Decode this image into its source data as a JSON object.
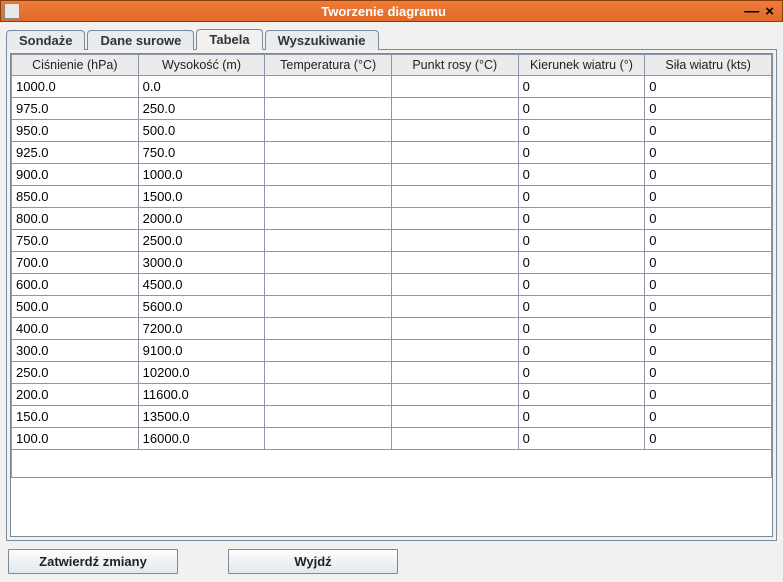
{
  "titlebar": {
    "title": "Tworzenie diagramu",
    "minimize": "—",
    "close": "×"
  },
  "tabs": {
    "items": [
      {
        "label": "Sondaże"
      },
      {
        "label": "Dane surowe"
      },
      {
        "label": "Tabela"
      },
      {
        "label": "Wyszukiwanie"
      }
    ]
  },
  "table": {
    "headers": {
      "pressure": "Ciśnienie (hPa)",
      "height": "Wysokość (m)",
      "temperature": "Temperatura (°C)",
      "dewpoint": "Punkt rosy (°C)",
      "winddir": "Kierunek wiatru (°)",
      "windspeed": "Siła wiatru (kts)"
    },
    "rows": [
      {
        "pressure": "1000.0",
        "height": "0.0",
        "temperature": "",
        "dewpoint": "",
        "winddir": "0",
        "windspeed": "0"
      },
      {
        "pressure": "975.0",
        "height": "250.0",
        "temperature": "",
        "dewpoint": "",
        "winddir": "0",
        "windspeed": "0"
      },
      {
        "pressure": "950.0",
        "height": "500.0",
        "temperature": "",
        "dewpoint": "",
        "winddir": "0",
        "windspeed": "0"
      },
      {
        "pressure": "925.0",
        "height": "750.0",
        "temperature": "",
        "dewpoint": "",
        "winddir": "0",
        "windspeed": "0"
      },
      {
        "pressure": "900.0",
        "height": "1000.0",
        "temperature": "",
        "dewpoint": "",
        "winddir": "0",
        "windspeed": "0"
      },
      {
        "pressure": "850.0",
        "height": "1500.0",
        "temperature": "",
        "dewpoint": "",
        "winddir": "0",
        "windspeed": "0"
      },
      {
        "pressure": "800.0",
        "height": "2000.0",
        "temperature": "",
        "dewpoint": "",
        "winddir": "0",
        "windspeed": "0"
      },
      {
        "pressure": "750.0",
        "height": "2500.0",
        "temperature": "",
        "dewpoint": "",
        "winddir": "0",
        "windspeed": "0"
      },
      {
        "pressure": "700.0",
        "height": "3000.0",
        "temperature": "",
        "dewpoint": "",
        "winddir": "0",
        "windspeed": "0"
      },
      {
        "pressure": "600.0",
        "height": "4500.0",
        "temperature": "",
        "dewpoint": "",
        "winddir": "0",
        "windspeed": "0"
      },
      {
        "pressure": "500.0",
        "height": "5600.0",
        "temperature": "",
        "dewpoint": "",
        "winddir": "0",
        "windspeed": "0"
      },
      {
        "pressure": "400.0",
        "height": "7200.0",
        "temperature": "",
        "dewpoint": "",
        "winddir": "0",
        "windspeed": "0"
      },
      {
        "pressure": "300.0",
        "height": "9100.0",
        "temperature": "",
        "dewpoint": "",
        "winddir": "0",
        "windspeed": "0"
      },
      {
        "pressure": "250.0",
        "height": "10200.0",
        "temperature": "",
        "dewpoint": "",
        "winddir": "0",
        "windspeed": "0"
      },
      {
        "pressure": "200.0",
        "height": "11600.0",
        "temperature": "",
        "dewpoint": "",
        "winddir": "0",
        "windspeed": "0"
      },
      {
        "pressure": "150.0",
        "height": "13500.0",
        "temperature": "",
        "dewpoint": "",
        "winddir": "0",
        "windspeed": "0"
      },
      {
        "pressure": "100.0",
        "height": "16000.0",
        "temperature": "",
        "dewpoint": "",
        "winddir": "0",
        "windspeed": "0"
      }
    ]
  },
  "buttons": {
    "apply": "Zatwierdź zmiany",
    "exit": "Wyjdź"
  }
}
